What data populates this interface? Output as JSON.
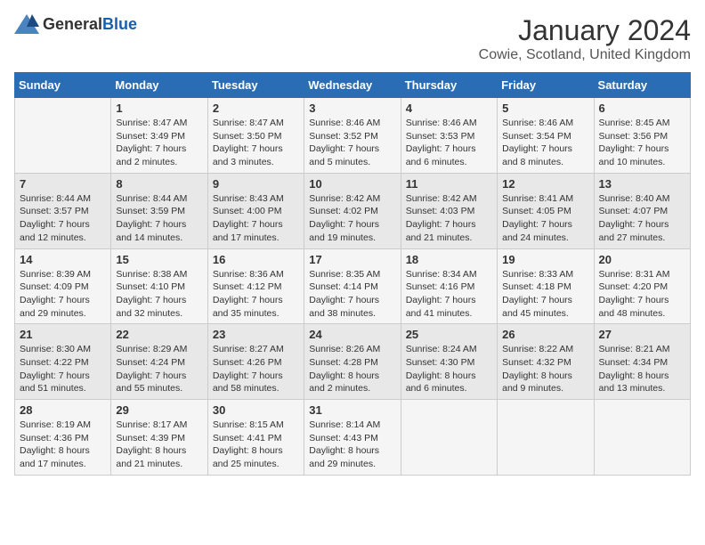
{
  "header": {
    "logo_general": "General",
    "logo_blue": "Blue",
    "month": "January 2024",
    "location": "Cowie, Scotland, United Kingdom"
  },
  "days_of_week": [
    "Sunday",
    "Monday",
    "Tuesday",
    "Wednesday",
    "Thursday",
    "Friday",
    "Saturday"
  ],
  "weeks": [
    [
      {
        "day": "",
        "sunrise": "",
        "sunset": "",
        "daylight": ""
      },
      {
        "day": "1",
        "sunrise": "Sunrise: 8:47 AM",
        "sunset": "Sunset: 3:49 PM",
        "daylight": "Daylight: 7 hours and 2 minutes."
      },
      {
        "day": "2",
        "sunrise": "Sunrise: 8:47 AM",
        "sunset": "Sunset: 3:50 PM",
        "daylight": "Daylight: 7 hours and 3 minutes."
      },
      {
        "day": "3",
        "sunrise": "Sunrise: 8:46 AM",
        "sunset": "Sunset: 3:52 PM",
        "daylight": "Daylight: 7 hours and 5 minutes."
      },
      {
        "day": "4",
        "sunrise": "Sunrise: 8:46 AM",
        "sunset": "Sunset: 3:53 PM",
        "daylight": "Daylight: 7 hours and 6 minutes."
      },
      {
        "day": "5",
        "sunrise": "Sunrise: 8:46 AM",
        "sunset": "Sunset: 3:54 PM",
        "daylight": "Daylight: 7 hours and 8 minutes."
      },
      {
        "day": "6",
        "sunrise": "Sunrise: 8:45 AM",
        "sunset": "Sunset: 3:56 PM",
        "daylight": "Daylight: 7 hours and 10 minutes."
      }
    ],
    [
      {
        "day": "7",
        "sunrise": "Sunrise: 8:44 AM",
        "sunset": "Sunset: 3:57 PM",
        "daylight": "Daylight: 7 hours and 12 minutes."
      },
      {
        "day": "8",
        "sunrise": "Sunrise: 8:44 AM",
        "sunset": "Sunset: 3:59 PM",
        "daylight": "Daylight: 7 hours and 14 minutes."
      },
      {
        "day": "9",
        "sunrise": "Sunrise: 8:43 AM",
        "sunset": "Sunset: 4:00 PM",
        "daylight": "Daylight: 7 hours and 17 minutes."
      },
      {
        "day": "10",
        "sunrise": "Sunrise: 8:42 AM",
        "sunset": "Sunset: 4:02 PM",
        "daylight": "Daylight: 7 hours and 19 minutes."
      },
      {
        "day": "11",
        "sunrise": "Sunrise: 8:42 AM",
        "sunset": "Sunset: 4:03 PM",
        "daylight": "Daylight: 7 hours and 21 minutes."
      },
      {
        "day": "12",
        "sunrise": "Sunrise: 8:41 AM",
        "sunset": "Sunset: 4:05 PM",
        "daylight": "Daylight: 7 hours and 24 minutes."
      },
      {
        "day": "13",
        "sunrise": "Sunrise: 8:40 AM",
        "sunset": "Sunset: 4:07 PM",
        "daylight": "Daylight: 7 hours and 27 minutes."
      }
    ],
    [
      {
        "day": "14",
        "sunrise": "Sunrise: 8:39 AM",
        "sunset": "Sunset: 4:09 PM",
        "daylight": "Daylight: 7 hours and 29 minutes."
      },
      {
        "day": "15",
        "sunrise": "Sunrise: 8:38 AM",
        "sunset": "Sunset: 4:10 PM",
        "daylight": "Daylight: 7 hours and 32 minutes."
      },
      {
        "day": "16",
        "sunrise": "Sunrise: 8:36 AM",
        "sunset": "Sunset: 4:12 PM",
        "daylight": "Daylight: 7 hours and 35 minutes."
      },
      {
        "day": "17",
        "sunrise": "Sunrise: 8:35 AM",
        "sunset": "Sunset: 4:14 PM",
        "daylight": "Daylight: 7 hours and 38 minutes."
      },
      {
        "day": "18",
        "sunrise": "Sunrise: 8:34 AM",
        "sunset": "Sunset: 4:16 PM",
        "daylight": "Daylight: 7 hours and 41 minutes."
      },
      {
        "day": "19",
        "sunrise": "Sunrise: 8:33 AM",
        "sunset": "Sunset: 4:18 PM",
        "daylight": "Daylight: 7 hours and 45 minutes."
      },
      {
        "day": "20",
        "sunrise": "Sunrise: 8:31 AM",
        "sunset": "Sunset: 4:20 PM",
        "daylight": "Daylight: 7 hours and 48 minutes."
      }
    ],
    [
      {
        "day": "21",
        "sunrise": "Sunrise: 8:30 AM",
        "sunset": "Sunset: 4:22 PM",
        "daylight": "Daylight: 7 hours and 51 minutes."
      },
      {
        "day": "22",
        "sunrise": "Sunrise: 8:29 AM",
        "sunset": "Sunset: 4:24 PM",
        "daylight": "Daylight: 7 hours and 55 minutes."
      },
      {
        "day": "23",
        "sunrise": "Sunrise: 8:27 AM",
        "sunset": "Sunset: 4:26 PM",
        "daylight": "Daylight: 7 hours and 58 minutes."
      },
      {
        "day": "24",
        "sunrise": "Sunrise: 8:26 AM",
        "sunset": "Sunset: 4:28 PM",
        "daylight": "Daylight: 8 hours and 2 minutes."
      },
      {
        "day": "25",
        "sunrise": "Sunrise: 8:24 AM",
        "sunset": "Sunset: 4:30 PM",
        "daylight": "Daylight: 8 hours and 6 minutes."
      },
      {
        "day": "26",
        "sunrise": "Sunrise: 8:22 AM",
        "sunset": "Sunset: 4:32 PM",
        "daylight": "Daylight: 8 hours and 9 minutes."
      },
      {
        "day": "27",
        "sunrise": "Sunrise: 8:21 AM",
        "sunset": "Sunset: 4:34 PM",
        "daylight": "Daylight: 8 hours and 13 minutes."
      }
    ],
    [
      {
        "day": "28",
        "sunrise": "Sunrise: 8:19 AM",
        "sunset": "Sunset: 4:36 PM",
        "daylight": "Daylight: 8 hours and 17 minutes."
      },
      {
        "day": "29",
        "sunrise": "Sunrise: 8:17 AM",
        "sunset": "Sunset: 4:39 PM",
        "daylight": "Daylight: 8 hours and 21 minutes."
      },
      {
        "day": "30",
        "sunrise": "Sunrise: 8:15 AM",
        "sunset": "Sunset: 4:41 PM",
        "daylight": "Daylight: 8 hours and 25 minutes."
      },
      {
        "day": "31",
        "sunrise": "Sunrise: 8:14 AM",
        "sunset": "Sunset: 4:43 PM",
        "daylight": "Daylight: 8 hours and 29 minutes."
      },
      {
        "day": "",
        "sunrise": "",
        "sunset": "",
        "daylight": ""
      },
      {
        "day": "",
        "sunrise": "",
        "sunset": "",
        "daylight": ""
      },
      {
        "day": "",
        "sunrise": "",
        "sunset": "",
        "daylight": ""
      }
    ]
  ]
}
